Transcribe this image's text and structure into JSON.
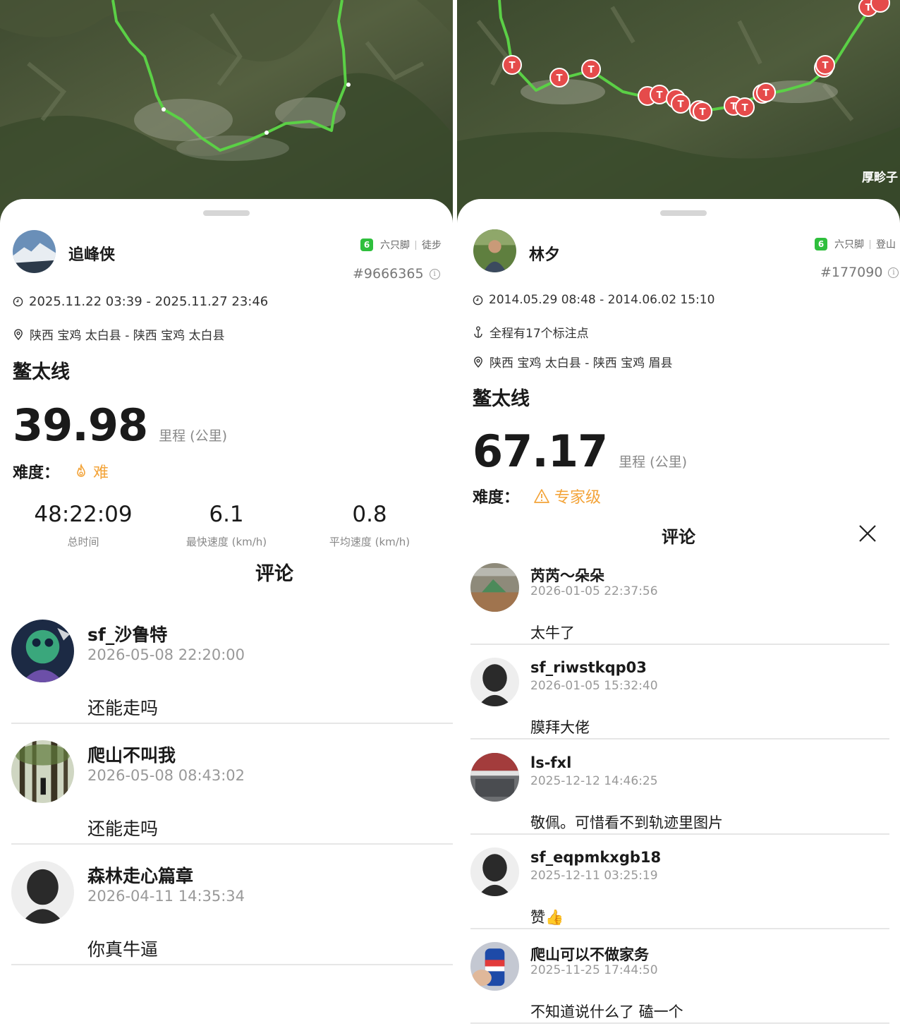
{
  "left": {
    "user": {
      "name": "追峰侠"
    },
    "brand": {
      "name": "六只脚",
      "activity": "徒步"
    },
    "track_id": "#9666365",
    "time_range": "2025.11.22 03:39 - 2025.11.27 23:46",
    "location": "陕西 宝鸡 太白县 - 陕西 宝鸡 太白县",
    "route_name": "鳌太线",
    "distance": {
      "value": "39.98",
      "unit": "里程 (公里)"
    },
    "difficulty": {
      "label": "难度：",
      "value": "难",
      "color": "#f3a43a",
      "icon": "flame-icon"
    },
    "stats": [
      {
        "value": "48:22:09",
        "label": "总时间"
      },
      {
        "value": "6.1",
        "label": "最快速度 (km/h)"
      },
      {
        "value": "0.8",
        "label": "平均速度 (km/h)"
      }
    ],
    "comments_title": "评论",
    "comments": [
      {
        "name": "sf_沙鲁特",
        "time": "2026-05-08 22:20:00",
        "text": "还能走吗"
      },
      {
        "name": "爬山不叫我",
        "time": "2026-05-08 08:43:02",
        "text": "还能走吗"
      },
      {
        "name": "森林走心篇章",
        "time": "2026-04-11 14:35:34",
        "text": "你真牛逼"
      }
    ]
  },
  "right": {
    "user": {
      "name": "林夕"
    },
    "brand": {
      "name": "六只脚",
      "activity": "登山"
    },
    "track_id": "#177090",
    "time_range": "2014.05.29 08:48 - 2014.06.02 15:10",
    "waypoints": "全程有17个标注点",
    "location": "陕西 宝鸡 太白县 - 陕西 宝鸡 眉县",
    "route_name": "鳌太线",
    "distance": {
      "value": "67.17",
      "unit": "里程 (公里)"
    },
    "difficulty": {
      "label": "难度：",
      "value": "专家级",
      "color": "#f3a43a",
      "icon": "warning-icon"
    },
    "map_label": "厚畛子",
    "comments_title": "评论",
    "comments": [
      {
        "name": "芮芮～朵朵",
        "time": "2026-01-05 22:37:56",
        "text": "太牛了"
      },
      {
        "name": "sf_riwstkqp03",
        "time": "2026-01-05 15:32:40",
        "text": "膜拜大佬"
      },
      {
        "name": "ls-fxl",
        "time": "2025-12-12 14:46:25",
        "text": "敬佩。可惜看不到轨迹里图片"
      },
      {
        "name": "sf_eqpmkxgb18",
        "time": "2025-12-11 03:25:19",
        "text": "赞👍"
      },
      {
        "name": "爬山可以不做家务",
        "time": "2025-11-25 17:44:50",
        "text": "不知道说什么了 磕一个"
      }
    ]
  },
  "colors": {
    "track": "#5bd046",
    "marker": "#e54b4b",
    "accent": "#f3a43a"
  }
}
